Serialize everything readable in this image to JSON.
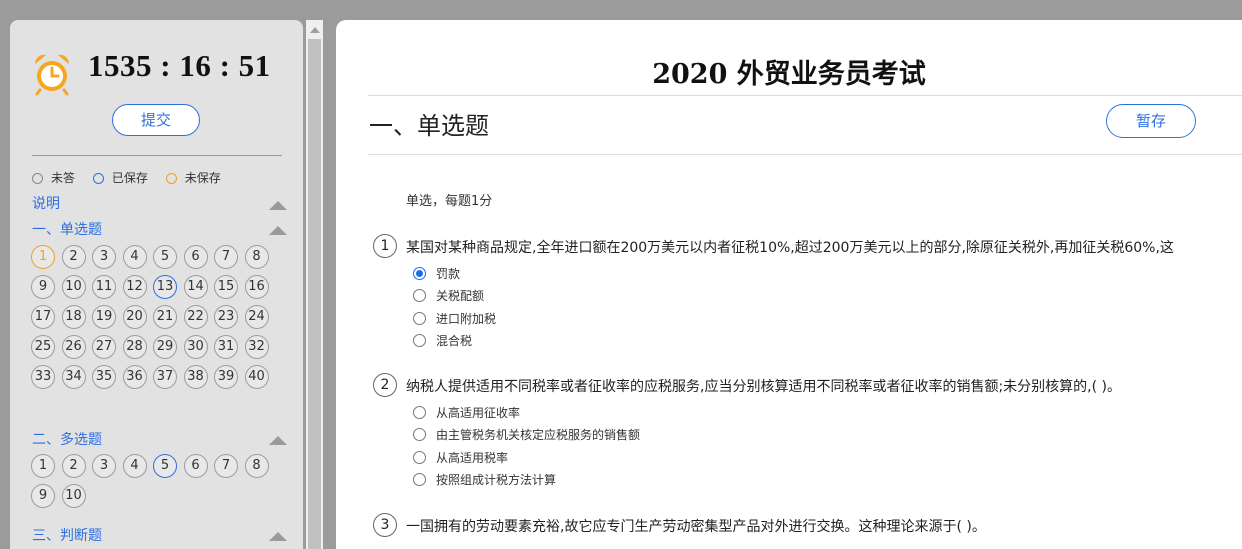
{
  "sidebar": {
    "timer": "1535 : 16 : 51",
    "submit_label": "提交",
    "legend": [
      {
        "label": "未答",
        "color": "#888888"
      },
      {
        "label": "已保存",
        "color": "#2e6fdf"
      },
      {
        "label": "未保存",
        "color": "#e9a326"
      }
    ],
    "explain_label": "说明",
    "sections": [
      {
        "title": "一、单选题",
        "count": 40,
        "unsaved": [
          1
        ],
        "saved": [
          13
        ]
      },
      {
        "title": "二、多选题",
        "count": 10,
        "unsaved": [],
        "saved": [
          5
        ]
      },
      {
        "title": "三、判断题",
        "count": 0,
        "unsaved": [],
        "saved": []
      }
    ]
  },
  "main": {
    "exam_title": "2020 外贸业务员考试",
    "section_heading": "一、单选题",
    "save_label": "暂存",
    "instructions": "单选，每题1分",
    "questions": [
      {
        "number": "1",
        "text": "某国对某种商品规定,全年进口额在200万美元以内者征税10%,超过200万美元以上的部分,除原征关税外,再加征关税60%,这",
        "options": [
          "罚款",
          "关税配额",
          "进口附加税",
          "混合税"
        ],
        "selected": 0
      },
      {
        "number": "2",
        "text": "纳税人提供适用不同税率或者征收率的应税服务,应当分别核算适用不同税率或者征收率的销售额;未分别核算的,( )。",
        "options": [
          "从高适用征收率",
          "由主管税务机关核定应税服务的销售额",
          "从高适用税率",
          "按照组成计税方法计算"
        ],
        "selected": -1
      },
      {
        "number": "3",
        "text": "一国拥有的劳动要素充裕,故它应专门生产劳动密集型产品对外进行交换。这种理论来源于( )。",
        "options": [],
        "selected": -1
      }
    ]
  },
  "colors": {
    "accent": "#2e6fdf",
    "unsaved": "#e9a326",
    "clock": "#f5a623"
  },
  "icons": {
    "clock": "alarm-clock-icon"
  }
}
